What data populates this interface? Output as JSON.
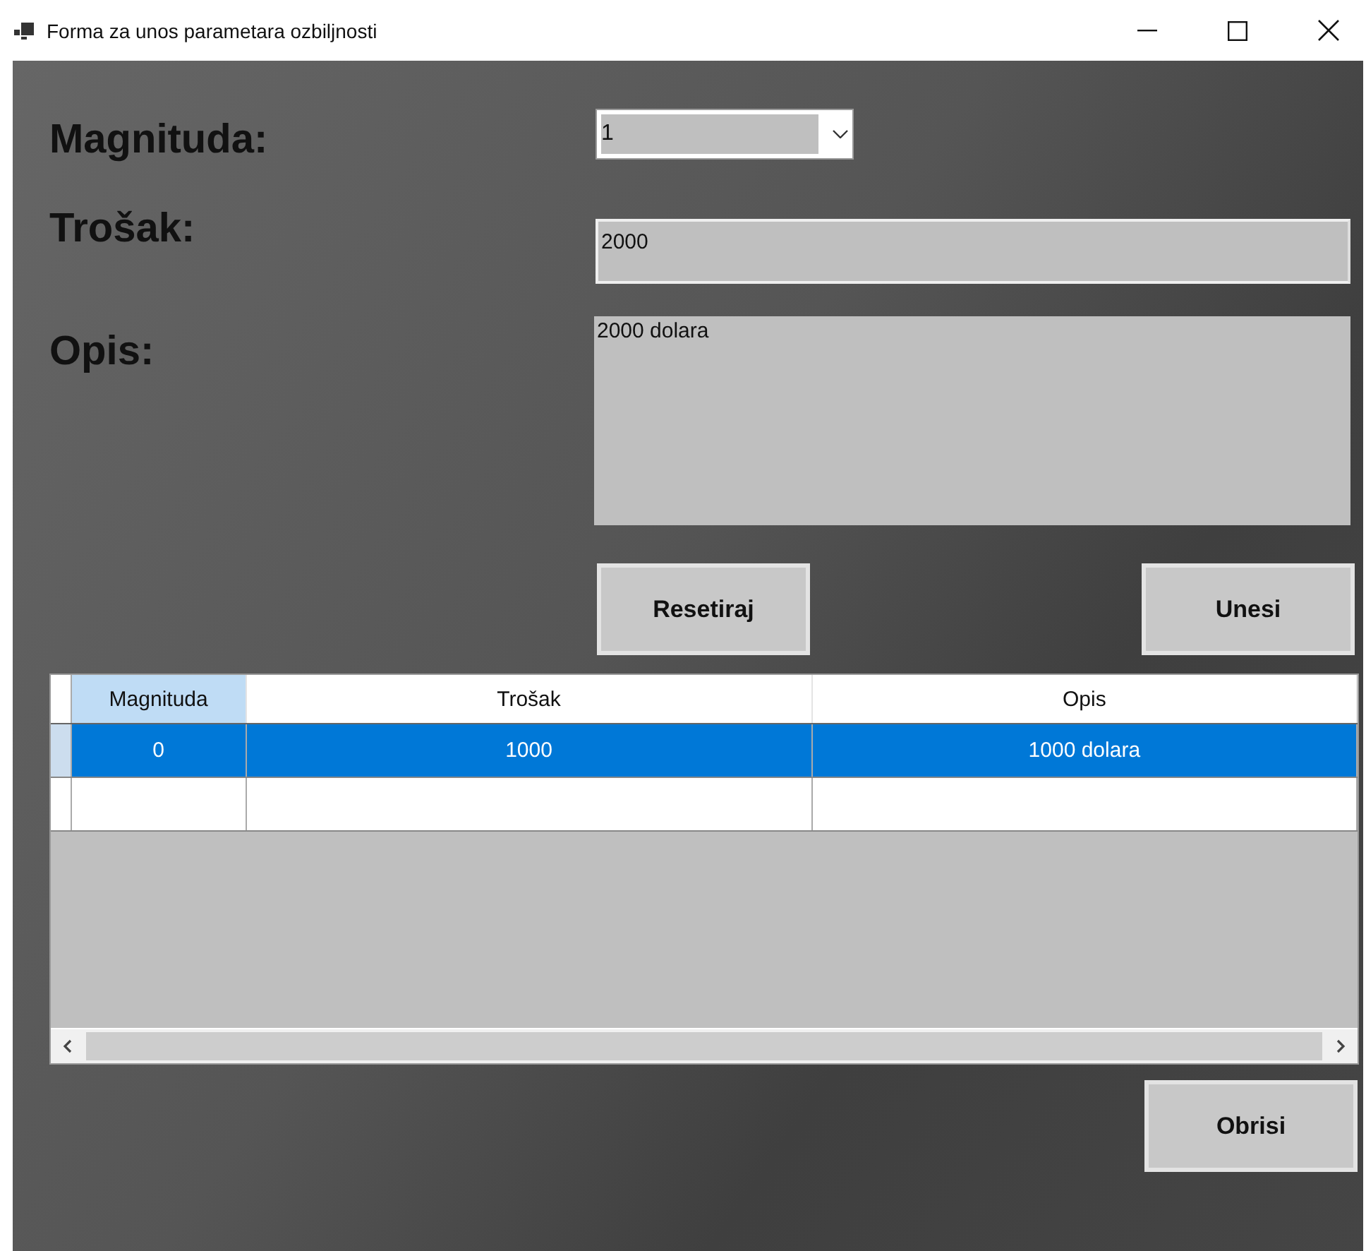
{
  "window": {
    "title": "Forma za unos parametara ozbiljnosti"
  },
  "form": {
    "magnitude_label": "Magnituda:",
    "magnitude_value": "1",
    "cost_label": "Trošak:",
    "cost_value": "2000",
    "description_label": "Opis:",
    "description_value": "2000 dolara"
  },
  "buttons": {
    "reset": "Resetiraj",
    "submit": "Unesi",
    "delete": "Obrisi"
  },
  "table": {
    "columns": [
      {
        "label": "Magnituda",
        "selected": true
      },
      {
        "label": "Trošak",
        "selected": false
      },
      {
        "label": "Opis",
        "selected": false
      }
    ],
    "rows": [
      {
        "kind": "data",
        "cells": [
          "0",
          "1000",
          "1000 dolara"
        ],
        "selected": true
      },
      {
        "kind": "new",
        "selected": false
      }
    ]
  }
}
